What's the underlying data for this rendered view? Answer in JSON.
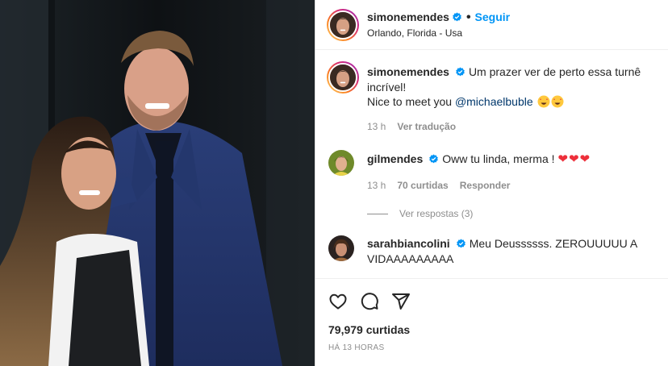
{
  "post": {
    "author": "simonemendes",
    "follow_label": "Seguir",
    "separator": "•",
    "location": "Orlando, Florida - Usa"
  },
  "comments": [
    {
      "username": "simonemendes",
      "text_line1": "Um prazer ver de perto essa turnê incrível!",
      "text_line2_prefix": "Nice to meet you ",
      "mention": "@michaelbuble",
      "time": "13 h",
      "translate_label": "Ver tradução"
    },
    {
      "username": "gilmendes",
      "text": "Oww tu linda, merma ! ",
      "hearts": "❤❤❤",
      "time": "13 h",
      "likes_label": "70 curtidas",
      "reply_label": "Responder",
      "view_replies_label": "Ver respostas (3)"
    },
    {
      "username": "sarahbiancolini",
      "text": "Meu Deussssss. ZEROUUUUU A VIDAAAAAAAAA"
    }
  ],
  "actions": {
    "like_icon": "heart-outline-icon",
    "comment_icon": "comment-bubble-icon",
    "share_icon": "paper-plane-icon"
  },
  "likes_count": "79,979 curtidas",
  "posted_ago": "HÁ 13 HORAS",
  "colors": {
    "accent": "#0095f6",
    "verified": "#0095f6",
    "meta": "#8e8e8e",
    "heart": "#ed2f3a"
  }
}
